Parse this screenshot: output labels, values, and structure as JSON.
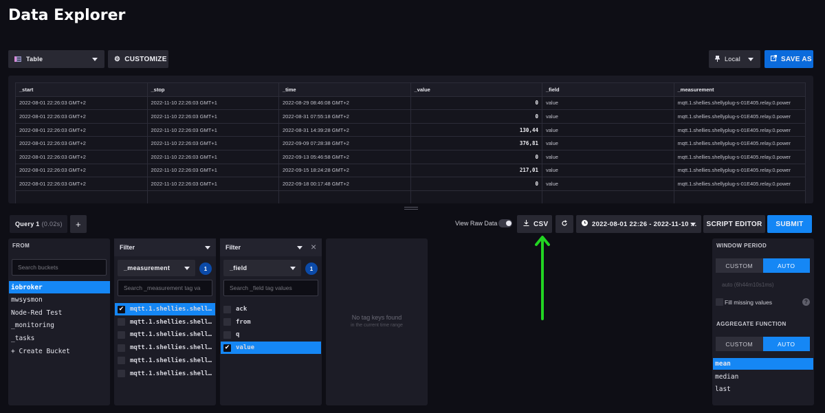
{
  "page_title": "Data Explorer",
  "toolbar": {
    "view_type": "Table",
    "customize_label": "CUSTOMIZE",
    "timezone": "Local",
    "save_as_label": "SAVE AS"
  },
  "table": {
    "columns": [
      "_start",
      "_stop",
      "_time",
      "_value",
      "_field",
      "_measurement"
    ],
    "rows": [
      [
        "2022-08-01 22:26:03 GMT+2",
        "2022-11-10 22:26:03 GMT+1",
        "2022-08-29 08:46:08 GMT+2",
        "0",
        "value",
        "mqtt.1.shellies.shellyplug-s-01E405.relay.0.power"
      ],
      [
        "2022-08-01 22:26:03 GMT+2",
        "2022-11-10 22:26:03 GMT+1",
        "2022-08-31 07:55:18 GMT+2",
        "0",
        "value",
        "mqtt.1.shellies.shellyplug-s-01E405.relay.0.power"
      ],
      [
        "2022-08-01 22:26:03 GMT+2",
        "2022-11-10 22:26:03 GMT+1",
        "2022-08-31 14:39:28 GMT+2",
        "130,44",
        "value",
        "mqtt.1.shellies.shellyplug-s-01E405.relay.0.power"
      ],
      [
        "2022-08-01 22:26:03 GMT+2",
        "2022-11-10 22:26:03 GMT+1",
        "2022-09-09 07:28:38 GMT+2",
        "376,81",
        "value",
        "mqtt.1.shellies.shellyplug-s-01E405.relay.0.power"
      ],
      [
        "2022-08-01 22:26:03 GMT+2",
        "2022-11-10 22:26:03 GMT+1",
        "2022-09-13 05:46:58 GMT+2",
        "0",
        "value",
        "mqtt.1.shellies.shellyplug-s-01E405.relay.0.power"
      ],
      [
        "2022-08-01 22:26:03 GMT+2",
        "2022-11-10 22:26:03 GMT+1",
        "2022-09-15 18:24:28 GMT+2",
        "217,01",
        "value",
        "mqtt.1.shellies.shellyplug-s-01E405.relay.0.power"
      ],
      [
        "2022-08-01 22:26:03 GMT+2",
        "2022-11-10 22:26:03 GMT+1",
        "2022-09-18 00:17:48 GMT+2",
        "0",
        "value",
        "mqtt.1.shellies.shellyplug-s-01E405.relay.0.power"
      ]
    ]
  },
  "query_bar": {
    "query_tab": "Query 1",
    "query_time": "(0.02s)",
    "add_label": "+",
    "raw_data_label": "View Raw Data",
    "csv_label": "CSV",
    "time_range": "2022-08-01 22:26 - 2022-11-10 ...",
    "script_editor_label": "SCRIPT EDITOR",
    "submit_label": "SUBMIT"
  },
  "from": {
    "header": "FROM",
    "search_placeholder": "Search buckets",
    "buckets": [
      "iobroker",
      "mwsysmon",
      "Node-Red Test",
      "_monitoring",
      "_tasks",
      "+ Create Bucket"
    ]
  },
  "filter1": {
    "header": "Filter",
    "key": "_measurement",
    "count": "1",
    "search_placeholder": "Search _measurement tag va",
    "values": [
      "mqtt.1.shellies.shell…",
      "mqtt.1.shellies.shell…",
      "mqtt.1.shellies.shell…",
      "mqtt.1.shellies.shell…",
      "mqtt.1.shellies.shell…",
      "mqtt.1.shellies.shell…"
    ]
  },
  "filter2": {
    "header": "Filter",
    "close": "×",
    "key": "_field",
    "count": "1",
    "search_placeholder": "Search _field tag values",
    "values": [
      "ack",
      "from",
      "q",
      "value"
    ]
  },
  "empty": {
    "title": "No tag keys found",
    "subtitle": "in the current time range"
  },
  "options": {
    "window_period_label": "WINDOW PERIOD",
    "custom_label": "CUSTOM",
    "auto_label": "AUTO",
    "auto_value": "auto (6h44m10s1ms)",
    "fill_missing_label": "Fill missing values",
    "help": "?",
    "aggregate_label": "AGGREGATE FUNCTION",
    "functions": [
      "mean",
      "median",
      "last"
    ]
  },
  "colors": {
    "accent": "#1587f5",
    "annotation_arrow": "#22d422"
  },
  "icons": {
    "table": "table-icon",
    "gear": "gear-icon",
    "pin": "pin-icon",
    "save": "export-icon",
    "download": "download-icon",
    "refresh": "refresh-icon",
    "clock": "clock-icon"
  }
}
